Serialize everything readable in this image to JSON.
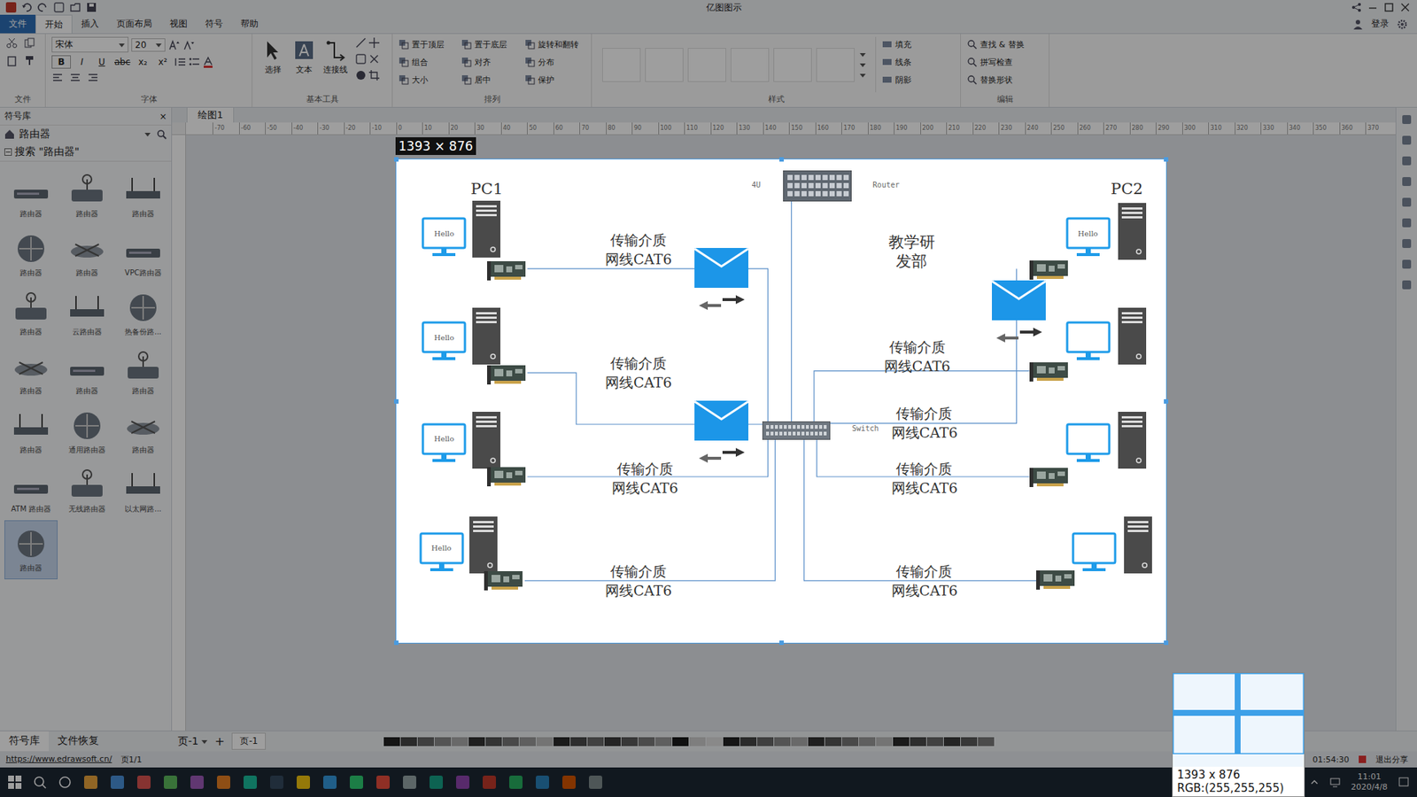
{
  "window": {
    "title": "亿图图示"
  },
  "account": {
    "label": "登录"
  },
  "ribbon": {
    "tabs": [
      {
        "label": "文件",
        "selected": false,
        "kind": "menu"
      },
      {
        "label": "开始",
        "selected": true,
        "kind": "tab"
      },
      {
        "label": "插入",
        "selected": false,
        "kind": "tab"
      },
      {
        "label": "页面布局",
        "selected": false,
        "kind": "tab"
      },
      {
        "label": "视图",
        "selected": false,
        "kind": "tab"
      },
      {
        "label": "符号",
        "selected": false,
        "kind": "tab"
      },
      {
        "label": "帮助",
        "selected": false,
        "kind": "tab"
      }
    ],
    "font": {
      "name": "宋体",
      "size": "20"
    },
    "font_buttons": [
      "B",
      "I",
      "U",
      "abc",
      "x₂",
      "x²"
    ],
    "tools": [
      "选择",
      "文本",
      "连接线"
    ],
    "arrange": [
      "置于顶层",
      "置于底层",
      "旋转和翻转",
      "组合",
      "对齐",
      "分布",
      "大小",
      "居中",
      "保护"
    ],
    "style_tools": [
      "填充",
      "线条",
      "阴影"
    ],
    "edit_tools": [
      "查找 & 替换",
      "拼写检查",
      "替换形状"
    ],
    "groups": [
      "文件",
      "字体",
      "基本工具",
      "排列",
      "样式",
      "编辑"
    ]
  },
  "library": {
    "title": "符号库",
    "close": "×",
    "category": "路由器",
    "search": "搜索 \"路由器\"",
    "items": [
      {
        "label": "路由器",
        "selected": false
      },
      {
        "label": "路由器",
        "selected": false
      },
      {
        "label": "路由器",
        "selected": false
      },
      {
        "label": "路由器",
        "selected": false
      },
      {
        "label": "路由器",
        "selected": false
      },
      {
        "label": "VPC路由器",
        "selected": false
      },
      {
        "label": "路由器",
        "selected": false
      },
      {
        "label": "云路由器",
        "selected": false
      },
      {
        "label": "热备份路...",
        "selected": false
      },
      {
        "label": "路由器",
        "selected": false
      },
      {
        "label": "路由器",
        "selected": false
      },
      {
        "label": "路由器",
        "selected": false
      },
      {
        "label": "路由器",
        "selected": false
      },
      {
        "label": "通用路由器",
        "selected": false
      },
      {
        "label": "路由器",
        "selected": false
      },
      {
        "label": "ATM 路由器",
        "selected": false
      },
      {
        "label": "无线路由器",
        "selected": false
      },
      {
        "label": "以太网路...",
        "selected": false
      },
      {
        "label": "路由器",
        "selected": true
      }
    ]
  },
  "document_tab": {
    "label": "绘图1"
  },
  "ruler": [
    "-70",
    "-60",
    "-50",
    "-40",
    "-30",
    "-20",
    "-10",
    "0",
    "10",
    "20",
    "30",
    "40",
    "50",
    "60",
    "70",
    "80",
    "90",
    "100",
    "110",
    "120",
    "130",
    "140",
    "150",
    "160",
    "170",
    "180",
    "190",
    "200",
    "210",
    "220",
    "230",
    "240",
    "250",
    "260",
    "270",
    "280",
    "290",
    "300",
    "310",
    "320",
    "330",
    "340",
    "350",
    "360",
    "370"
  ],
  "diagram": {
    "selection_size": "1393 × 876",
    "groups": [
      {
        "title": "PC1"
      },
      {
        "title": "PC2"
      }
    ],
    "department": "教学研发部",
    "router": {
      "label": "Router",
      "unit": "4U"
    },
    "switch": {
      "label": "Switch"
    },
    "pcs": [
      {
        "side": "left",
        "kind": "hello",
        "screen": "Hello"
      },
      {
        "side": "left",
        "kind": "hello",
        "screen": "Hello"
      },
      {
        "side": "left",
        "kind": "hello",
        "screen": "Hello"
      },
      {
        "side": "left",
        "kind": "hello",
        "screen": "Hello"
      },
      {
        "side": "right",
        "kind": "hello",
        "screen": "Hello"
      },
      {
        "side": "right",
        "kind": "blank"
      },
      {
        "side": "right",
        "kind": "blank"
      },
      {
        "side": "right",
        "kind": "blank"
      }
    ],
    "links": [
      {
        "medium": "传输介质",
        "cable": "网线CAT6"
      },
      {
        "medium": "传输介质",
        "cable": "网线CAT6"
      },
      {
        "medium": "传输介质",
        "cable": "网线CAT6"
      },
      {
        "medium": "传输介质",
        "cable": "网线CAT6"
      },
      {
        "medium": "传输介质",
        "cable": "网线CAT6"
      },
      {
        "medium": "传输介质",
        "cable": "网线CAT6"
      },
      {
        "medium": "传输介质",
        "cable": "网线CAT6"
      },
      {
        "medium": "传输介质",
        "cable": "网线CAT6"
      }
    ]
  },
  "pages": {
    "current": "页-1",
    "add": "+",
    "tabs": [
      {
        "label": "页-1",
        "selected": true
      }
    ]
  },
  "panel_tabs": [
    {
      "label": "符号库",
      "selected": true
    },
    {
      "label": "文件恢复",
      "selected": false
    }
  ],
  "status_bar": {
    "url": "https://www.edrawsoft.cn/",
    "page": "页1/1"
  },
  "recorder": {
    "elapsed": "01:54:30",
    "stop": "退出分享"
  },
  "taskbar": {
    "time": "11:01",
    "date": "2020/4/8"
  },
  "magnifier": {
    "size": "1393 x 876",
    "rgb": "RGB:(255,255,255)"
  }
}
